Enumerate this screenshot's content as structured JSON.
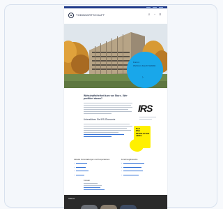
{
  "header": {
    "logo_text": "TOBINWIRTSCHAFT",
    "icons": [
      "search-icon",
      "user-icon",
      "menu-icon"
    ]
  },
  "hero": {
    "kicker": "Forum:",
    "title": "Wachstum braucht Stabilität",
    "arrow": "›",
    "slide_count": 4
  },
  "main": {
    "headline": "Wirtschaftsfreiheit kurz vor Sturz - Wer profitiert davon?",
    "subheadline": "Unterstützen Sie IRS-Ökonomie"
  },
  "sidebar": {
    "logo_text": "IRS",
    "promo_text": "Neu!\nRSS\nNEWSLETTER\nLINKS"
  },
  "columns": [
    {
      "heading": "Aktuelle Veranstaltungen und Kooperationen",
      "item_count": 4
    },
    {
      "heading": "Forschungsbereiche",
      "item_count": 4
    }
  ],
  "contact": {
    "heading": "Kontakt"
  },
  "footer": {
    "label": "Videos"
  },
  "colors": {
    "accent_blue": "#19a7ea",
    "nav_blue": "#1f3a8a",
    "promo_yellow": "#fff000",
    "footer_dark": "#2a2a2a"
  }
}
